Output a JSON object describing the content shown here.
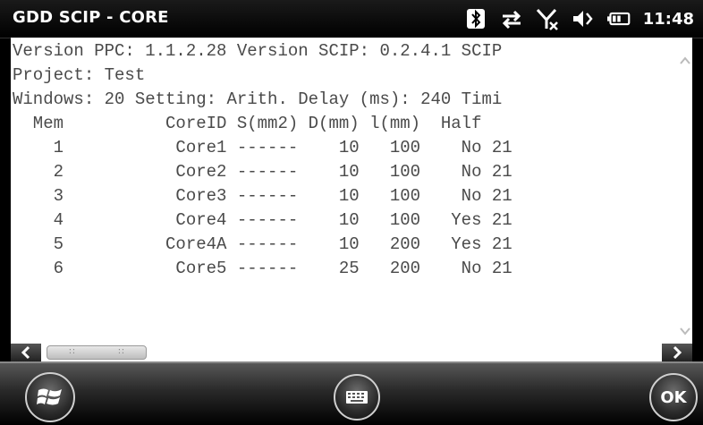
{
  "titlebar": {
    "title": "GDD SCIP - CORE",
    "time": "11:48",
    "icons": [
      "bluetooth-icon",
      "data-sync-icon",
      "no-signal-icon",
      "volume-icon",
      "battery-icon"
    ]
  },
  "content": {
    "lines": [
      "Version PPC: 1.1.2.28 Version SCIP: 0.2.4.1 SCIP",
      "Project: Test",
      "Windows: 20 Setting: Arith. Delay (ms): 240 Timi",
      "  Mem          CoreID S(mm2) D(mm) l(mm)  Half",
      "    1           Core1 ------    10   100    No 21",
      "    2           Core2 ------    10   100    No 21",
      "    3           Core3 ------    10   100    No 21",
      "    4           Core4 ------    10   100   Yes 21",
      "    5          Core4A ------    10   200   Yes 21",
      "    6           Core5 ------    25   200    No 21"
    ]
  },
  "softkeys": {
    "ok_label": "OK"
  },
  "colors": {
    "background": "#000000",
    "content_bg": "#ffffff",
    "text": "#4a4a4a"
  }
}
